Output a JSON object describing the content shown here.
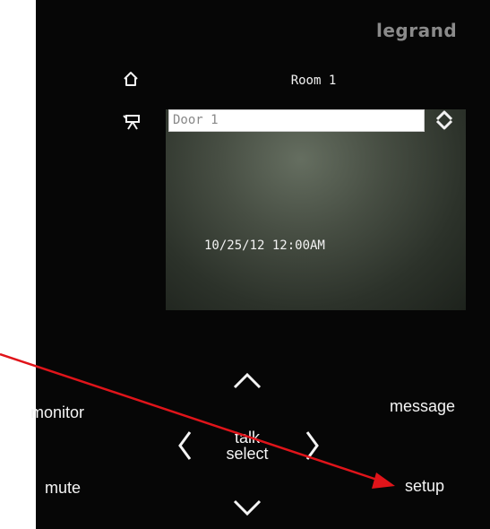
{
  "brand": "legrand",
  "screen": {
    "title": "Room 1",
    "door_field": "Door 1",
    "datetime": "10/25/12 12:00AM"
  },
  "buttons": {
    "monitor": "monitor",
    "mute": "mute",
    "message": "message",
    "setup": "setup",
    "talk": "talk",
    "select": "select"
  },
  "icons": {
    "home": "home-icon",
    "camera": "camera-icon",
    "updown": "updown-icon",
    "up": "chevron-up-icon",
    "down": "chevron-down-icon",
    "left": "chevron-left-icon",
    "right": "chevron-right-icon"
  },
  "colors": {
    "panel": "#060606",
    "annotation_arrow": "#e0141a",
    "label": "#f4f4f4",
    "brand": "#8a8a8a"
  }
}
